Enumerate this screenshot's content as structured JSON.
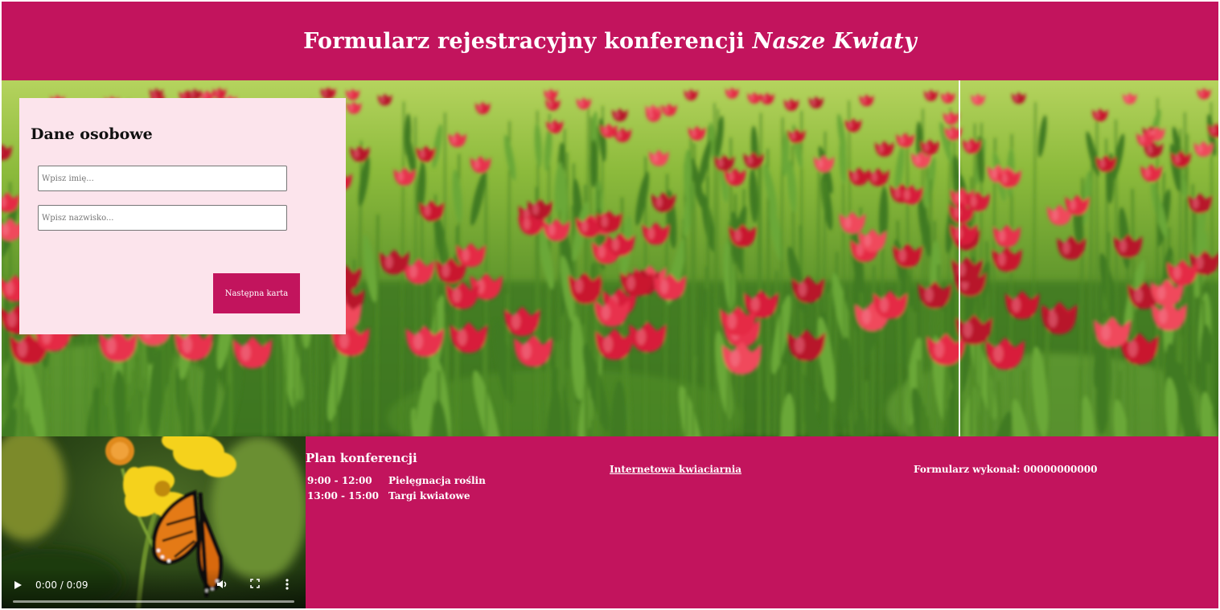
{
  "header": {
    "title_plain": "Formularz rejestracyjny konferencji ",
    "title_italic": "Nasze Kwiaty"
  },
  "form": {
    "heading": "Dane osobowe",
    "first_name_placeholder": "Wpisz imię...",
    "last_name_placeholder": "Wpisz nazwisko...",
    "next_button": "Następna karta"
  },
  "video": {
    "time": "0:00 / 0:09",
    "progress": 0,
    "icons": [
      "play-icon",
      "volume-icon",
      "fullscreen-icon",
      "more-vertical-icon"
    ]
  },
  "plan": {
    "heading": "Plan konferencji",
    "rows": [
      {
        "time": "9:00 - 12:00",
        "topic": "Pielęgnacja roślin"
      },
      {
        "time": "13:00 - 15:00",
        "topic": "Targi kwiatowe"
      }
    ]
  },
  "footer": {
    "shop_link": "Internetowa kwiaciarnia",
    "author": "Formularz wykonał: 00000000000"
  },
  "colors": {
    "accent": "#c2145d",
    "card_bg": "#fce4ec"
  }
}
